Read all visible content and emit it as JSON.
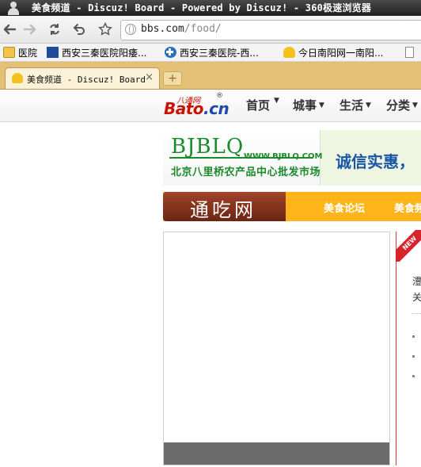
{
  "window": {
    "title": "美食频道 - Discuz! Board - Powered by Discuz! - 360极速浏览器"
  },
  "toolbar": {
    "url_host": "bbs.com",
    "url_path": "/food/"
  },
  "bookmarks": [
    {
      "label": "医院",
      "icon": "folder-icon"
    },
    {
      "label": "西安三秦医院阳痿...",
      "icon": "site-logo-icon"
    },
    {
      "label": "西安三秦医院-西...",
      "icon": "medical-cross-icon"
    },
    {
      "label": "今日南阳网一南阳...",
      "icon": "trophy-icon"
    }
  ],
  "tab": {
    "label": "美食频道 - Discuz! Board",
    "close": "×"
  },
  "site": {
    "logo_cn": "八通网",
    "logo_reg": "®",
    "logo_brand_a": "Bato",
    "logo_brand_b": ".cn",
    "nav": [
      {
        "label": "首页"
      },
      {
        "label": "城事"
      },
      {
        "label": "生活"
      },
      {
        "label": "分类"
      }
    ]
  },
  "banner": {
    "logo_text": "BJBLQ",
    "www": "WWW.BJBLQ.COM",
    "market": "北京八里桥农产品中心批发市场",
    "slogan": "诚信实惠，"
  },
  "channel": {
    "brand": "通吃网",
    "links": [
      {
        "label": "美食论坛"
      },
      {
        "label": "美食频"
      }
    ]
  },
  "side": {
    "badge": "NEW",
    "line1": "澧",
    "line2": "关"
  },
  "colors": {
    "tabstrip": "#e4bf76",
    "channel_bar": "#ffb51a",
    "brand_red": "#cc1100",
    "banner_green": "#1a8a2b"
  }
}
